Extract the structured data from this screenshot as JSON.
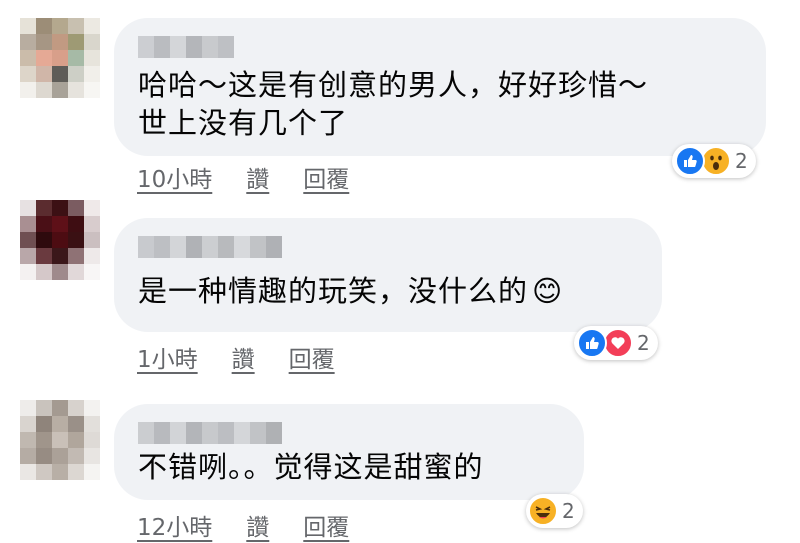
{
  "colors": {
    "bubble": "#f0f2f5",
    "text": "#050505",
    "meta": "#65676b",
    "like": "#1877f2",
    "love": "#f33e58",
    "haha": "#f7b125"
  },
  "comments": [
    {
      "text_line1": "哈哈～这是有创意的男人，好好珍惜～",
      "text_line2": "世上没有几个了",
      "time": "10小時",
      "like_label": "讚",
      "reply_label": "回覆",
      "reactions": [
        "like-icon",
        "wow-icon"
      ],
      "reaction_count": "2"
    },
    {
      "text_line1": "是一种情趣的玩笑，没什么的",
      "emoji": "😊",
      "time": "1小時",
      "like_label": "讚",
      "reply_label": "回覆",
      "reactions": [
        "like-icon",
        "love-icon"
      ],
      "reaction_count": "2"
    },
    {
      "text_line1": "不错咧。。觉得这是甜蜜的",
      "time": "12小時",
      "like_label": "讚",
      "reply_label": "回覆",
      "reactions": [
        "haha-icon"
      ],
      "reaction_count": "2"
    }
  ]
}
